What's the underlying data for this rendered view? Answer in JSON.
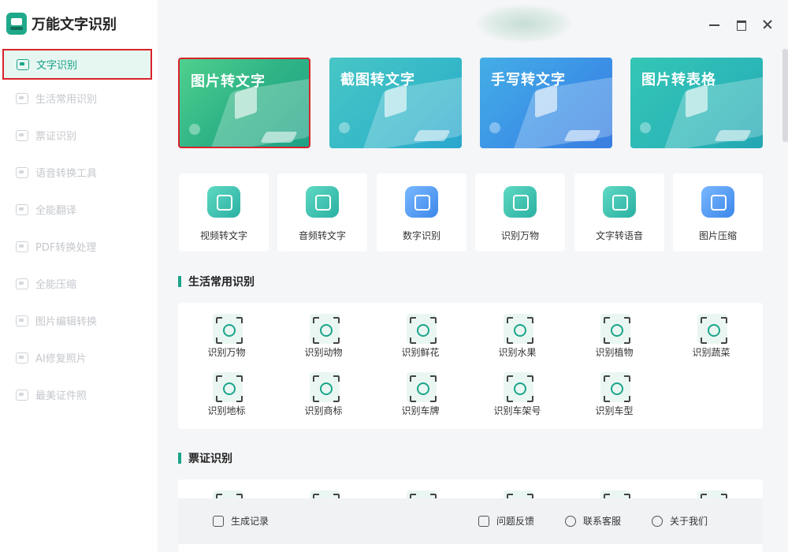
{
  "app": {
    "title": "万能文字识别"
  },
  "sidebar": {
    "items": [
      {
        "label": "文字识别",
        "icon": "text-recognition-icon",
        "active": true
      },
      {
        "label": "生活常用识别",
        "icon": "life-recognition-icon"
      },
      {
        "label": "票证识别",
        "icon": "ticket-recognition-icon"
      },
      {
        "label": "语音转换工具",
        "icon": "voice-convert-icon"
      },
      {
        "label": "全能翻译",
        "icon": "translate-icon"
      },
      {
        "label": "PDF转换处理",
        "icon": "pdf-icon"
      },
      {
        "label": "全能压缩",
        "icon": "compress-icon"
      },
      {
        "label": "图片编辑转换",
        "icon": "image-edit-icon"
      },
      {
        "label": "AI修复照片",
        "icon": "ai-repair-icon"
      },
      {
        "label": "最美证件照",
        "icon": "id-photo-icon"
      }
    ]
  },
  "banners": [
    {
      "label": "图片转文字",
      "color": "#2fb386"
    },
    {
      "label": "截图转文字",
      "color": "#34b7c8"
    },
    {
      "label": "手写转文字",
      "color": "#3b8fe6"
    },
    {
      "label": "图片转表格",
      "color": "#2bb6b7"
    }
  ],
  "tools": [
    {
      "label": "视频转文字",
      "icon": "video-text-icon"
    },
    {
      "label": "音频转文字",
      "icon": "audio-text-icon"
    },
    {
      "label": "数字识别",
      "icon": "digit-icon"
    },
    {
      "label": "识别万物",
      "icon": "eye-icon"
    },
    {
      "label": "文字转语音",
      "icon": "text-to-speech-icon"
    },
    {
      "label": "图片压缩",
      "icon": "image-compress-icon"
    }
  ],
  "life_section": {
    "title": "生活常用识别",
    "items": [
      {
        "label": "识别万物",
        "icon": "eye-icon"
      },
      {
        "label": "识别动物",
        "icon": "animal-icon"
      },
      {
        "label": "识别鲜花",
        "icon": "flower-icon"
      },
      {
        "label": "识别水果",
        "icon": "fruit-icon"
      },
      {
        "label": "识别植物",
        "icon": "plant-icon"
      },
      {
        "label": "识别蔬菜",
        "icon": "vegetable-icon"
      },
      {
        "label": "识别地标",
        "icon": "landmark-icon"
      },
      {
        "label": "识别商标",
        "icon": "trademark-icon"
      },
      {
        "label": "识别车牌",
        "icon": "license-plate-icon"
      },
      {
        "label": "识别车架号",
        "icon": "vin-icon"
      },
      {
        "label": "识别车型",
        "icon": "car-model-icon"
      }
    ]
  },
  "ticket_section": {
    "title": "票证识别"
  },
  "bottom_bar": {
    "history": "生成记录",
    "feedback": "问题反馈",
    "support": "联系客服",
    "about": "关于我们"
  },
  "colors": {
    "accent": "#1aa58b",
    "highlight_border": "#d9232c"
  }
}
